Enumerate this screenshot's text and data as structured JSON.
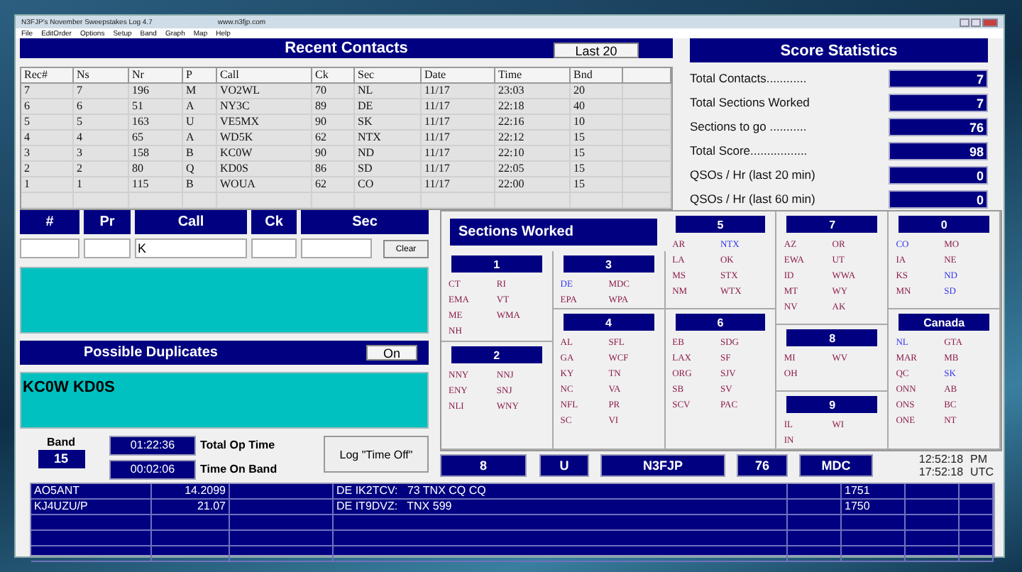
{
  "window": {
    "title": "N3FJP's November Sweepstakes Log 4.7",
    "url": "www.n3fjp.com"
  },
  "menu": [
    "File",
    "EditOrder",
    "Options",
    "Setup",
    "Band",
    "Graph",
    "Map",
    "Help"
  ],
  "recent_contacts": {
    "title": "Recent Contacts",
    "last_button": "Last 20",
    "columns": [
      "Rec#",
      "Ns",
      "Nr",
      "P",
      "Call",
      "Ck",
      "Sec",
      "Date",
      "Time",
      "Bnd"
    ],
    "rows": [
      [
        "7",
        "7",
        "196",
        "M",
        "VO2WL",
        "70",
        "NL",
        "11/17",
        "23:03",
        "20"
      ],
      [
        "6",
        "6",
        "51",
        "A",
        "NY3C",
        "89",
        "DE",
        "11/17",
        "22:18",
        "40"
      ],
      [
        "5",
        "5",
        "163",
        "U",
        "VE5MX",
        "90",
        "SK",
        "11/17",
        "22:16",
        "10"
      ],
      [
        "4",
        "4",
        "65",
        "A",
        "WD5K",
        "62",
        "NTX",
        "11/17",
        "22:12",
        "15"
      ],
      [
        "3",
        "3",
        "158",
        "B",
        "KC0W",
        "90",
        "ND",
        "11/17",
        "22:10",
        "15"
      ],
      [
        "2",
        "2",
        "80",
        "Q",
        "KD0S",
        "86",
        "SD",
        "11/17",
        "22:05",
        "15"
      ],
      [
        "1",
        "1",
        "115",
        "B",
        "WOUA",
        "62",
        "CO",
        "11/17",
        "22:00",
        "15"
      ]
    ]
  },
  "score_statistics": {
    "title": "Score Statistics",
    "items": [
      {
        "label": "Total Contacts............",
        "value": "7"
      },
      {
        "label": "Total Sections Worked",
        "value": "7"
      },
      {
        "label": "Sections to go ...........",
        "value": "76"
      },
      {
        "label": "Total Score.................",
        "value": "98"
      },
      {
        "label": "QSOs / Hr (last 20 min)",
        "value": "0"
      },
      {
        "label": "QSOs / Hr (last 60 min)",
        "value": "0"
      }
    ]
  },
  "entry": {
    "fields": [
      {
        "label": "#"
      },
      {
        "label": "Pr"
      },
      {
        "label": "Call",
        "value": "K"
      },
      {
        "label": "Ck"
      },
      {
        "label": "Sec"
      }
    ],
    "clear_button": "Clear"
  },
  "duplicates": {
    "title": "Possible Duplicates",
    "toggle": "On",
    "calls": "KC0W KD0S"
  },
  "band": {
    "label": "Band",
    "value": "15"
  },
  "times": [
    {
      "value": "01:22:36",
      "label": "Total Op Time"
    },
    {
      "value": "00:02:06",
      "label": "Time On Band"
    }
  ],
  "log_button": "Log \"Time Off\"",
  "sections_worked": {
    "title": "Sections Worked",
    "groups": [
      {
        "name": "1",
        "sections": [
          {
            "code": "CT",
            "worked": false
          },
          {
            "code": "RI",
            "worked": false
          },
          {
            "code": "EMA",
            "worked": false
          },
          {
            "code": "VT",
            "worked": false
          },
          {
            "code": "ME",
            "worked": false
          },
          {
            "code": "WMA",
            "worked": false
          },
          {
            "code": "NH",
            "worked": false
          }
        ]
      },
      {
        "name": "2",
        "sections": [
          {
            "code": "NNY",
            "worked": false
          },
          {
            "code": "NNJ",
            "worked": false
          },
          {
            "code": "ENY",
            "worked": false
          },
          {
            "code": "SNJ",
            "worked": false
          },
          {
            "code": "NLI",
            "worked": false
          },
          {
            "code": "WNY",
            "worked": false
          }
        ]
      },
      {
        "name": "3",
        "sections": [
          {
            "code": "DE",
            "worked": true
          },
          {
            "code": "MDC",
            "worked": false
          },
          {
            "code": "EPA",
            "worked": false
          },
          {
            "code": "WPA",
            "worked": false
          }
        ]
      },
      {
        "name": "4",
        "sections": [
          {
            "code": "AL",
            "worked": false
          },
          {
            "code": "SFL",
            "worked": false
          },
          {
            "code": "GA",
            "worked": false
          },
          {
            "code": "WCF",
            "worked": false
          },
          {
            "code": "KY",
            "worked": false
          },
          {
            "code": "TN",
            "worked": false
          },
          {
            "code": "NC",
            "worked": false
          },
          {
            "code": "VA",
            "worked": false
          },
          {
            "code": "NFL",
            "worked": false
          },
          {
            "code": "PR",
            "worked": false
          },
          {
            "code": "SC",
            "worked": false
          },
          {
            "code": "VI",
            "worked": false
          }
        ]
      },
      {
        "name": "5",
        "sections": [
          {
            "code": "AR",
            "worked": false
          },
          {
            "code": "NTX",
            "worked": true
          },
          {
            "code": "LA",
            "worked": false
          },
          {
            "code": "OK",
            "worked": false
          },
          {
            "code": "MS",
            "worked": false
          },
          {
            "code": "STX",
            "worked": false
          },
          {
            "code": "NM",
            "worked": false
          },
          {
            "code": "WTX",
            "worked": false
          }
        ]
      },
      {
        "name": "6",
        "sections": [
          {
            "code": "EB",
            "worked": false
          },
          {
            "code": "SDG",
            "worked": false
          },
          {
            "code": "LAX",
            "worked": false
          },
          {
            "code": "SF",
            "worked": false
          },
          {
            "code": "ORG",
            "worked": false
          },
          {
            "code": "SJV",
            "worked": false
          },
          {
            "code": "SB",
            "worked": false
          },
          {
            "code": "SV",
            "worked": false
          },
          {
            "code": "SCV",
            "worked": false
          },
          {
            "code": "PAC",
            "worked": false
          }
        ]
      },
      {
        "name": "7",
        "sections": [
          {
            "code": "AZ",
            "worked": false
          },
          {
            "code": "OR",
            "worked": false
          },
          {
            "code": "EWA",
            "worked": false
          },
          {
            "code": "UT",
            "worked": false
          },
          {
            "code": "ID",
            "worked": false
          },
          {
            "code": "WWA",
            "worked": false
          },
          {
            "code": "MT",
            "worked": false
          },
          {
            "code": "WY",
            "worked": false
          },
          {
            "code": "NV",
            "worked": false
          },
          {
            "code": "AK",
            "worked": false
          }
        ]
      },
      {
        "name": "8",
        "sections": [
          {
            "code": "MI",
            "worked": false
          },
          {
            "code": "WV",
            "worked": false
          },
          {
            "code": "OH",
            "worked": false
          }
        ]
      },
      {
        "name": "9",
        "sections": [
          {
            "code": "IL",
            "worked": false
          },
          {
            "code": "WI",
            "worked": false
          },
          {
            "code": "IN",
            "worked": false
          }
        ]
      },
      {
        "name": "0",
        "sections": [
          {
            "code": "CO",
            "worked": true
          },
          {
            "code": "MO",
            "worked": false
          },
          {
            "code": "IA",
            "worked": false
          },
          {
            "code": "NE",
            "worked": false
          },
          {
            "code": "KS",
            "worked": false
          },
          {
            "code": "ND",
            "worked": true
          },
          {
            "code": "MN",
            "worked": false
          },
          {
            "code": "SD",
            "worked": true
          }
        ]
      },
      {
        "name": "Canada",
        "sections": [
          {
            "code": "NL",
            "worked": true
          },
          {
            "code": "GTA",
            "worked": false
          },
          {
            "code": "MAR",
            "worked": false
          },
          {
            "code": "MB",
            "worked": false
          },
          {
            "code": "QC",
            "worked": false
          },
          {
            "code": "SK",
            "worked": true
          },
          {
            "code": "ONN",
            "worked": false
          },
          {
            "code": "AB",
            "worked": false
          },
          {
            "code": "ONS",
            "worked": false
          },
          {
            "code": "BC",
            "worked": false
          },
          {
            "code": "ONE",
            "worked": false
          },
          {
            "code": "NT",
            "worked": false
          }
        ]
      }
    ]
  },
  "exchange": [
    "8",
    "U",
    "N3FJP",
    "76",
    "MDC"
  ],
  "clock": [
    {
      "time": "12:52:18",
      "suffix": "PM"
    },
    {
      "time": "17:52:18",
      "suffix": "UTC"
    }
  ],
  "spots": [
    {
      "call": "AO5ANT",
      "freq": "14.2099",
      "message": "DE IK2TCV:   73 TNX CQ CQ",
      "time": "1751"
    },
    {
      "call": "KJ4UZU/P",
      "freq": "21.07",
      "message": "DE IT9DVZ:   TNX 599",
      "time": "1750"
    }
  ]
}
